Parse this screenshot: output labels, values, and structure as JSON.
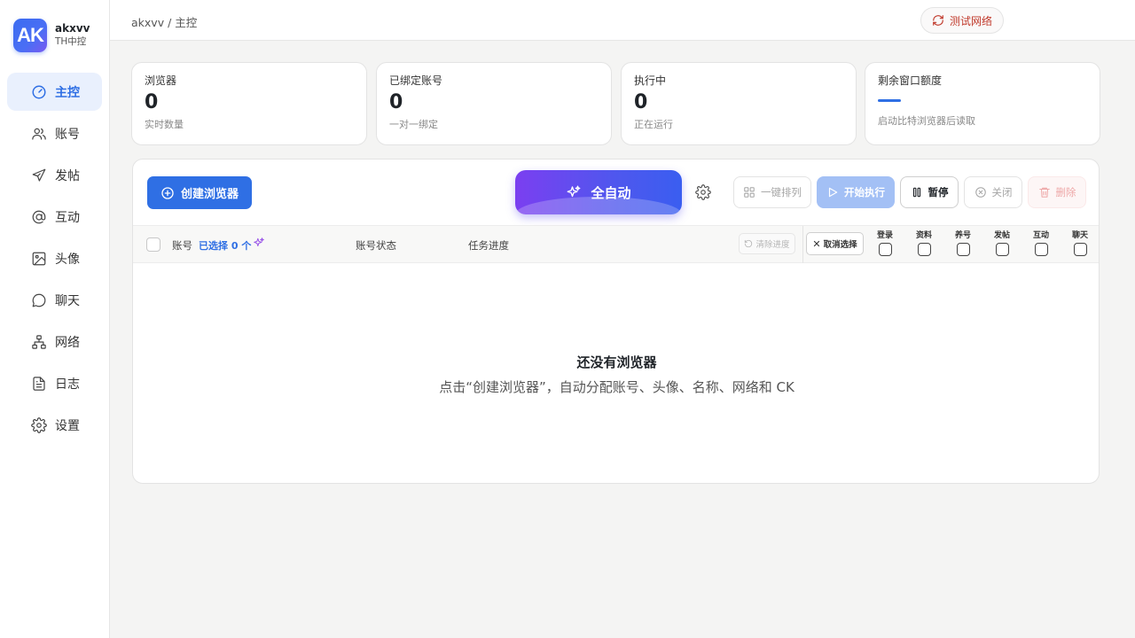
{
  "brand": {
    "logo_text": "AK",
    "name": "akxvv",
    "subtitle": "TH中控"
  },
  "sidebar": {
    "items": [
      {
        "label": "主控",
        "icon": "gauge-icon",
        "active": true
      },
      {
        "label": "账号",
        "icon": "users-icon"
      },
      {
        "label": "发帖",
        "icon": "send-icon"
      },
      {
        "label": "互动",
        "icon": "at-icon"
      },
      {
        "label": "头像",
        "icon": "image-icon"
      },
      {
        "label": "聊天",
        "icon": "chat-icon"
      },
      {
        "label": "网络",
        "icon": "network-icon"
      },
      {
        "label": "日志",
        "icon": "log-icon"
      },
      {
        "label": "设置",
        "icon": "settings-icon"
      }
    ]
  },
  "header": {
    "breadcrumb": "akxvv / 主控",
    "test_network_label": "测试网络"
  },
  "stats": [
    {
      "title": "浏览器",
      "value": "0",
      "sub": "实时数量"
    },
    {
      "title": "已绑定账号",
      "value": "0",
      "sub": "一对一绑定"
    },
    {
      "title": "执行中",
      "value": "0",
      "sub": "正在运行"
    },
    {
      "title": "剩余窗口额度",
      "value": "",
      "sub": "启动比特浏览器后读取"
    }
  ],
  "toolbar": {
    "create_label": "创建浏览器",
    "auto_label": "全自动",
    "arrange_label": "一键排列",
    "start_label": "开始执行",
    "pause_label": "暂停",
    "close_label": "关闭",
    "delete_label": "删除"
  },
  "table": {
    "col_account": "账号",
    "selected_text": "已选择 0 个",
    "col_status": "账号状态",
    "col_progress": "任务进度",
    "clear_progress_label": "清除进度",
    "cancel_select_label": "取消选择",
    "task_columns": [
      "登录",
      "资料",
      "养号",
      "发帖",
      "互动",
      "聊天"
    ]
  },
  "empty": {
    "title": "还没有浏览器",
    "subtitle": "点击“创建浏览器”，自动分配账号、头像、名称、网络和 CK"
  },
  "colors": {
    "accent": "#2f6fe4",
    "danger": "#c0392b",
    "auto_gradient_start": "#7b3ff0",
    "auto_gradient_end": "#3a5ef0"
  }
}
